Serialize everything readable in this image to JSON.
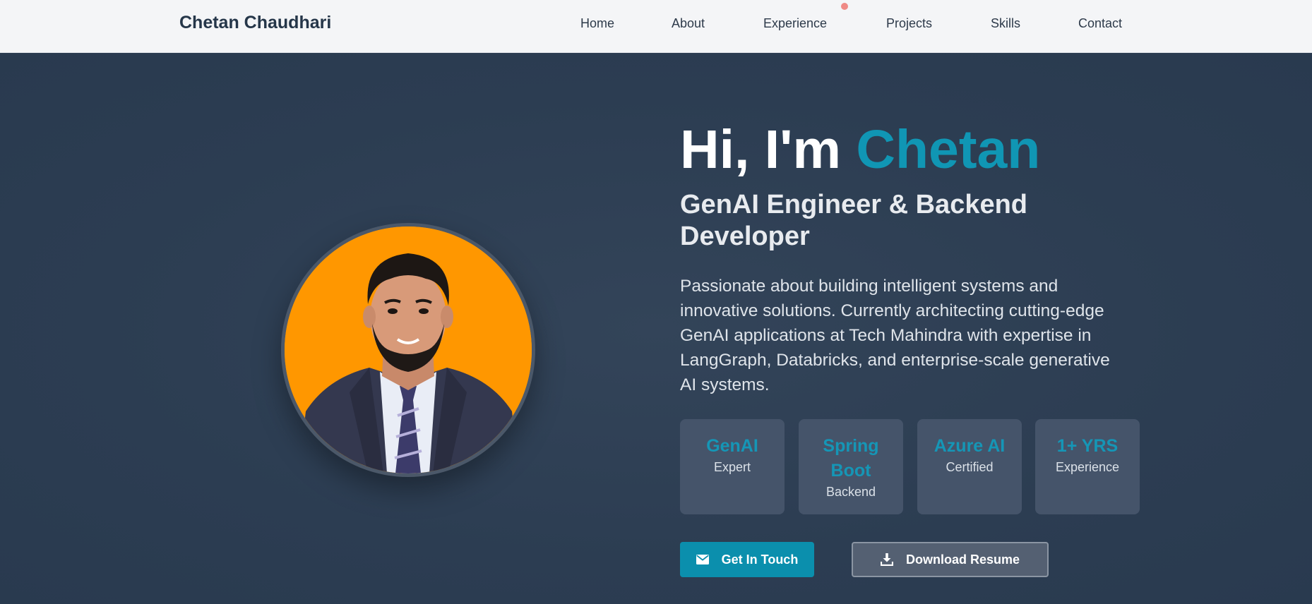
{
  "header": {
    "brand": "Chetan Chaudhari",
    "nav": [
      "Home",
      "About",
      "Experience",
      "Projects",
      "Skills",
      "Contact"
    ]
  },
  "hero": {
    "greeting_prefix": "Hi, I'm ",
    "greeting_name": "Chetan",
    "role": "GenAI Engineer & Backend Developer",
    "bio": "Passionate about building intelligent systems and innovative solutions. Currently architecting cutting-edge GenAI applications at Tech Mahindra with expertise in LangGraph, Databricks, and enterprise-scale generative AI systems.",
    "stats": [
      {
        "value": "GenAI",
        "label": "Expert"
      },
      {
        "value": "Spring Boot",
        "label": "Backend"
      },
      {
        "value": "Azure AI",
        "label": "Certified"
      },
      {
        "value": "1+ YRS",
        "label": "Experience"
      }
    ],
    "cta_primary": "Get In Touch",
    "cta_secondary": "Download Resume",
    "icons": {
      "primary": "envelope-icon",
      "secondary": "download-icon"
    }
  },
  "colors": {
    "accent": "#1096b4",
    "hero_bg": "#2c3e52",
    "nav_bg": "#f4f5f7",
    "avatar_bg": "#ff9700",
    "card_bg": "#45546a",
    "nav_indicator": "#ef8a86"
  }
}
